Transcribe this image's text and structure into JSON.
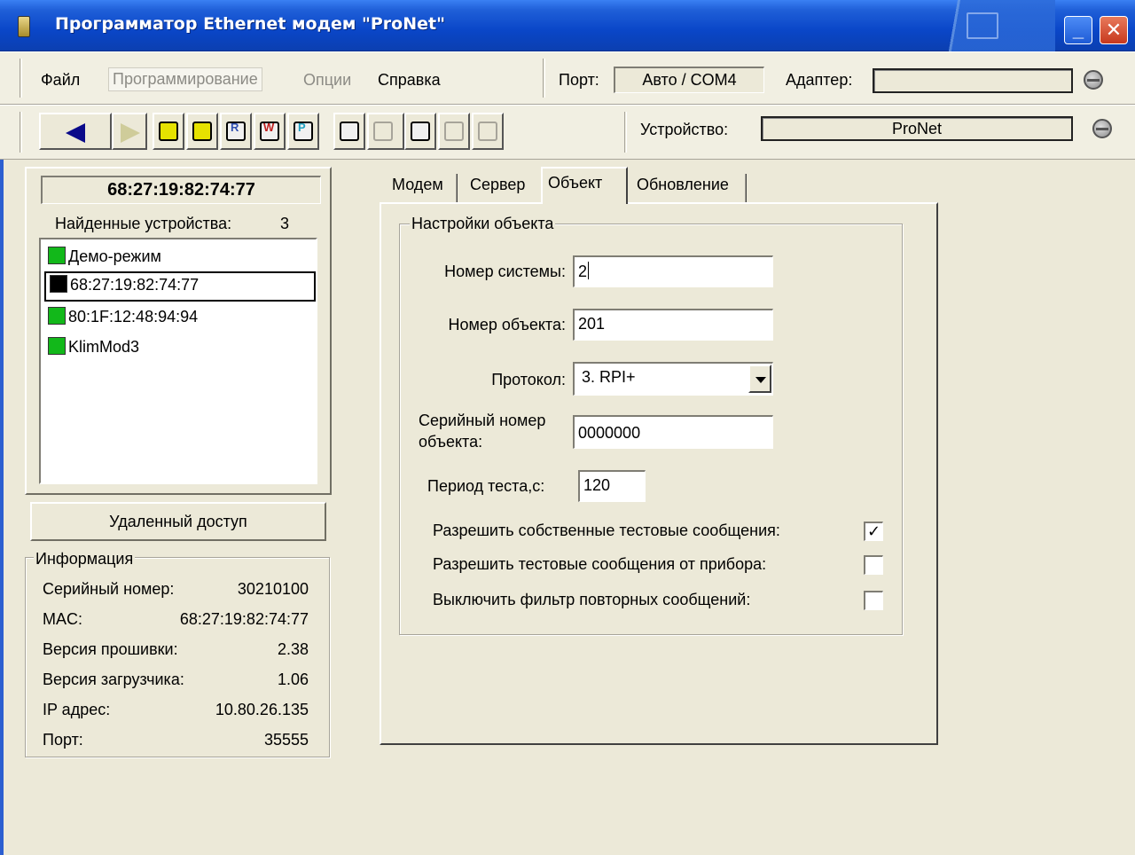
{
  "window": {
    "title": "Программатор Ethernet модем \"ProNet\""
  },
  "menu": {
    "file": "Файл",
    "programming": "Программирование",
    "options": "Опции",
    "help": "Справка",
    "port_label": "Порт:",
    "port_value": "Авто / COM4",
    "adapter_label": "Адаптер:",
    "adapter_value": ""
  },
  "toolbar": {
    "device_label": "Устройство:",
    "device_value": "ProNet"
  },
  "left_panel": {
    "selected_mac": "68:27:19:82:74:77",
    "found_label": "Найденные устройства:",
    "found_count": "3",
    "devices": [
      {
        "label": "Демо-режим",
        "color": "#12b81a"
      },
      {
        "label": "68:27:19:82:74:77",
        "color": "#000000"
      },
      {
        "label": "80:1F:12:48:94:94",
        "color": "#12b81a"
      },
      {
        "label": "KlimMod3",
        "color": "#12b81a"
      }
    ],
    "remote_access_button": "Удаленный доступ",
    "info": {
      "title": "Информация",
      "rows": [
        {
          "label": "Серийный номер:",
          "value": "30210100"
        },
        {
          "label": "MAC:",
          "value": "68:27:19:82:74:77"
        },
        {
          "label": "Версия прошивки:",
          "value": "2.38"
        },
        {
          "label": "Версия загрузчика:",
          "value": "1.06"
        },
        {
          "label": "IP адрес:",
          "value": "10.80.26.135"
        },
        {
          "label": "Порт:",
          "value": "35555"
        }
      ]
    }
  },
  "tabs": [
    "Модем",
    "Сервер",
    "Объект",
    "Обновление"
  ],
  "active_tab": "Объект",
  "object_settings": {
    "group_title": "Настройки объекта",
    "system_number_label": "Номер системы:",
    "system_number_value": "2",
    "object_number_label": "Номер объекта:",
    "object_number_value": "201",
    "protocol_label": "Протокол:",
    "protocol_value": "3. RPI+",
    "serial_label_line1": "Серийный номер",
    "serial_label_line2": "объекта:",
    "serial_value": "0000000",
    "test_period_label": "Период теста,с:",
    "test_period_value": "120",
    "checkboxes": [
      {
        "label": "Разрешить собственные тестовые сообщения:",
        "checked": true
      },
      {
        "label": "Разрешить тестовые сообщения от прибора:",
        "checked": false
      },
      {
        "label": "Выключить фильтр повторных сообщений:",
        "checked": false
      }
    ]
  }
}
